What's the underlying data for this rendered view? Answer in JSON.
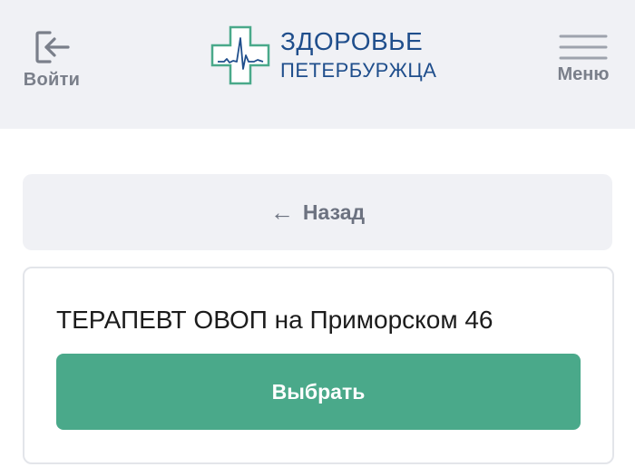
{
  "header": {
    "login_label": "Войти",
    "login_icon": "login-icon",
    "logo": {
      "line1": "ЗДОРОВЬЕ",
      "line2": "ПЕТЕРБУРЖЦА",
      "icon": "medical-cross-cardiogram-icon",
      "brand_color": "#1f4e8c",
      "cross_color": "#4aa98a"
    },
    "menu_label": "Меню",
    "menu_icon": "hamburger-menu-icon"
  },
  "back": {
    "arrow": "←",
    "label": "Назад"
  },
  "card": {
    "title": "ТЕРАПЕВТ ОВОП на Приморском 46",
    "select_label": "Выбрать",
    "accent_color": "#4aa98a"
  }
}
